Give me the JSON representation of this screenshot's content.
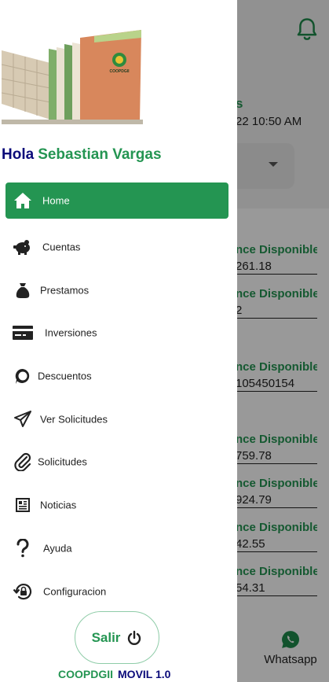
{
  "background": {
    "title_fragment": "s",
    "date_fragment": "22 10:50 AM",
    "accounts": [
      {
        "label": "nce Disponible",
        "value": "261.18"
      },
      {
        "label": "nce Disponible",
        "value": "2"
      },
      {
        "label": "nce Disponible",
        "value": "105450154"
      },
      {
        "label": "nce Disponible",
        "value": "759.78"
      },
      {
        "label": "nce Disponible",
        "value": "924.79"
      },
      {
        "label": "nce Disponible",
        "value": "42.55"
      },
      {
        "label": "nce Disponible",
        "value": "54.31"
      }
    ],
    "whatsapp_label": "Whatsapp"
  },
  "drawer": {
    "logo_text": "COOPDGII",
    "greeting": {
      "hola": "Hola",
      "name": "Sebastian Vargas"
    },
    "menu": [
      {
        "label": "Home",
        "icon": "home-icon",
        "active": true
      },
      {
        "label": "Cuentas",
        "icon": "piggy-bank-icon"
      },
      {
        "label": "Prestamos",
        "icon": "money-bag-icon"
      },
      {
        "label": "Inversiones",
        "icon": "credit-card-icon"
      },
      {
        "label": "Descuentos",
        "icon": "chat-bubble-icon"
      },
      {
        "label": "Ver Solicitudes",
        "icon": "send-icon"
      },
      {
        "label": "Solicitudes",
        "icon": "paperclip-icon"
      },
      {
        "label": "Noticias",
        "icon": "newspaper-icon"
      },
      {
        "label": "Ayuda",
        "icon": "question-icon"
      },
      {
        "label": "Configuracion",
        "icon": "lock-reset-icon"
      }
    ],
    "logout_label": "Salir",
    "footer": {
      "app_name": "COOPDGII",
      "version": "MOVIL 1.0"
    }
  },
  "colors": {
    "primary_green": "#249552",
    "navy": "#0b0b7a"
  }
}
